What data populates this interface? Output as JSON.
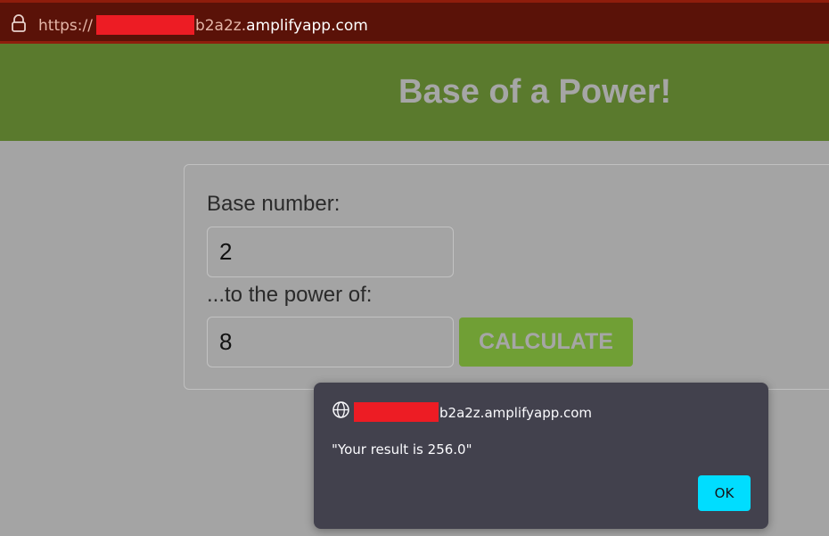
{
  "browser": {
    "url_scheme": "https://",
    "url_host_suffix": "b2a2z.",
    "url_domain": "amplifyapp.com",
    "icon": "lock-icon"
  },
  "page": {
    "title": "Base of a Power!",
    "colors": {
      "header_bg": "#5a7a2d",
      "button_bg": "#709f35",
      "page_bg": "#a4a4a4"
    }
  },
  "form": {
    "base_label": "Base number:",
    "base_value": "2",
    "power_label": "...to the power of:",
    "power_value": "8",
    "calculate_label": "CALCULATE"
  },
  "dialog": {
    "icon": "globe-icon",
    "origin_suffix": "b2a2z.amplifyapp.com",
    "message": "\"Your result is 256.0\"",
    "ok_label": "OK",
    "colors": {
      "bg": "#42414d",
      "ok_bg": "#00ddff"
    }
  }
}
